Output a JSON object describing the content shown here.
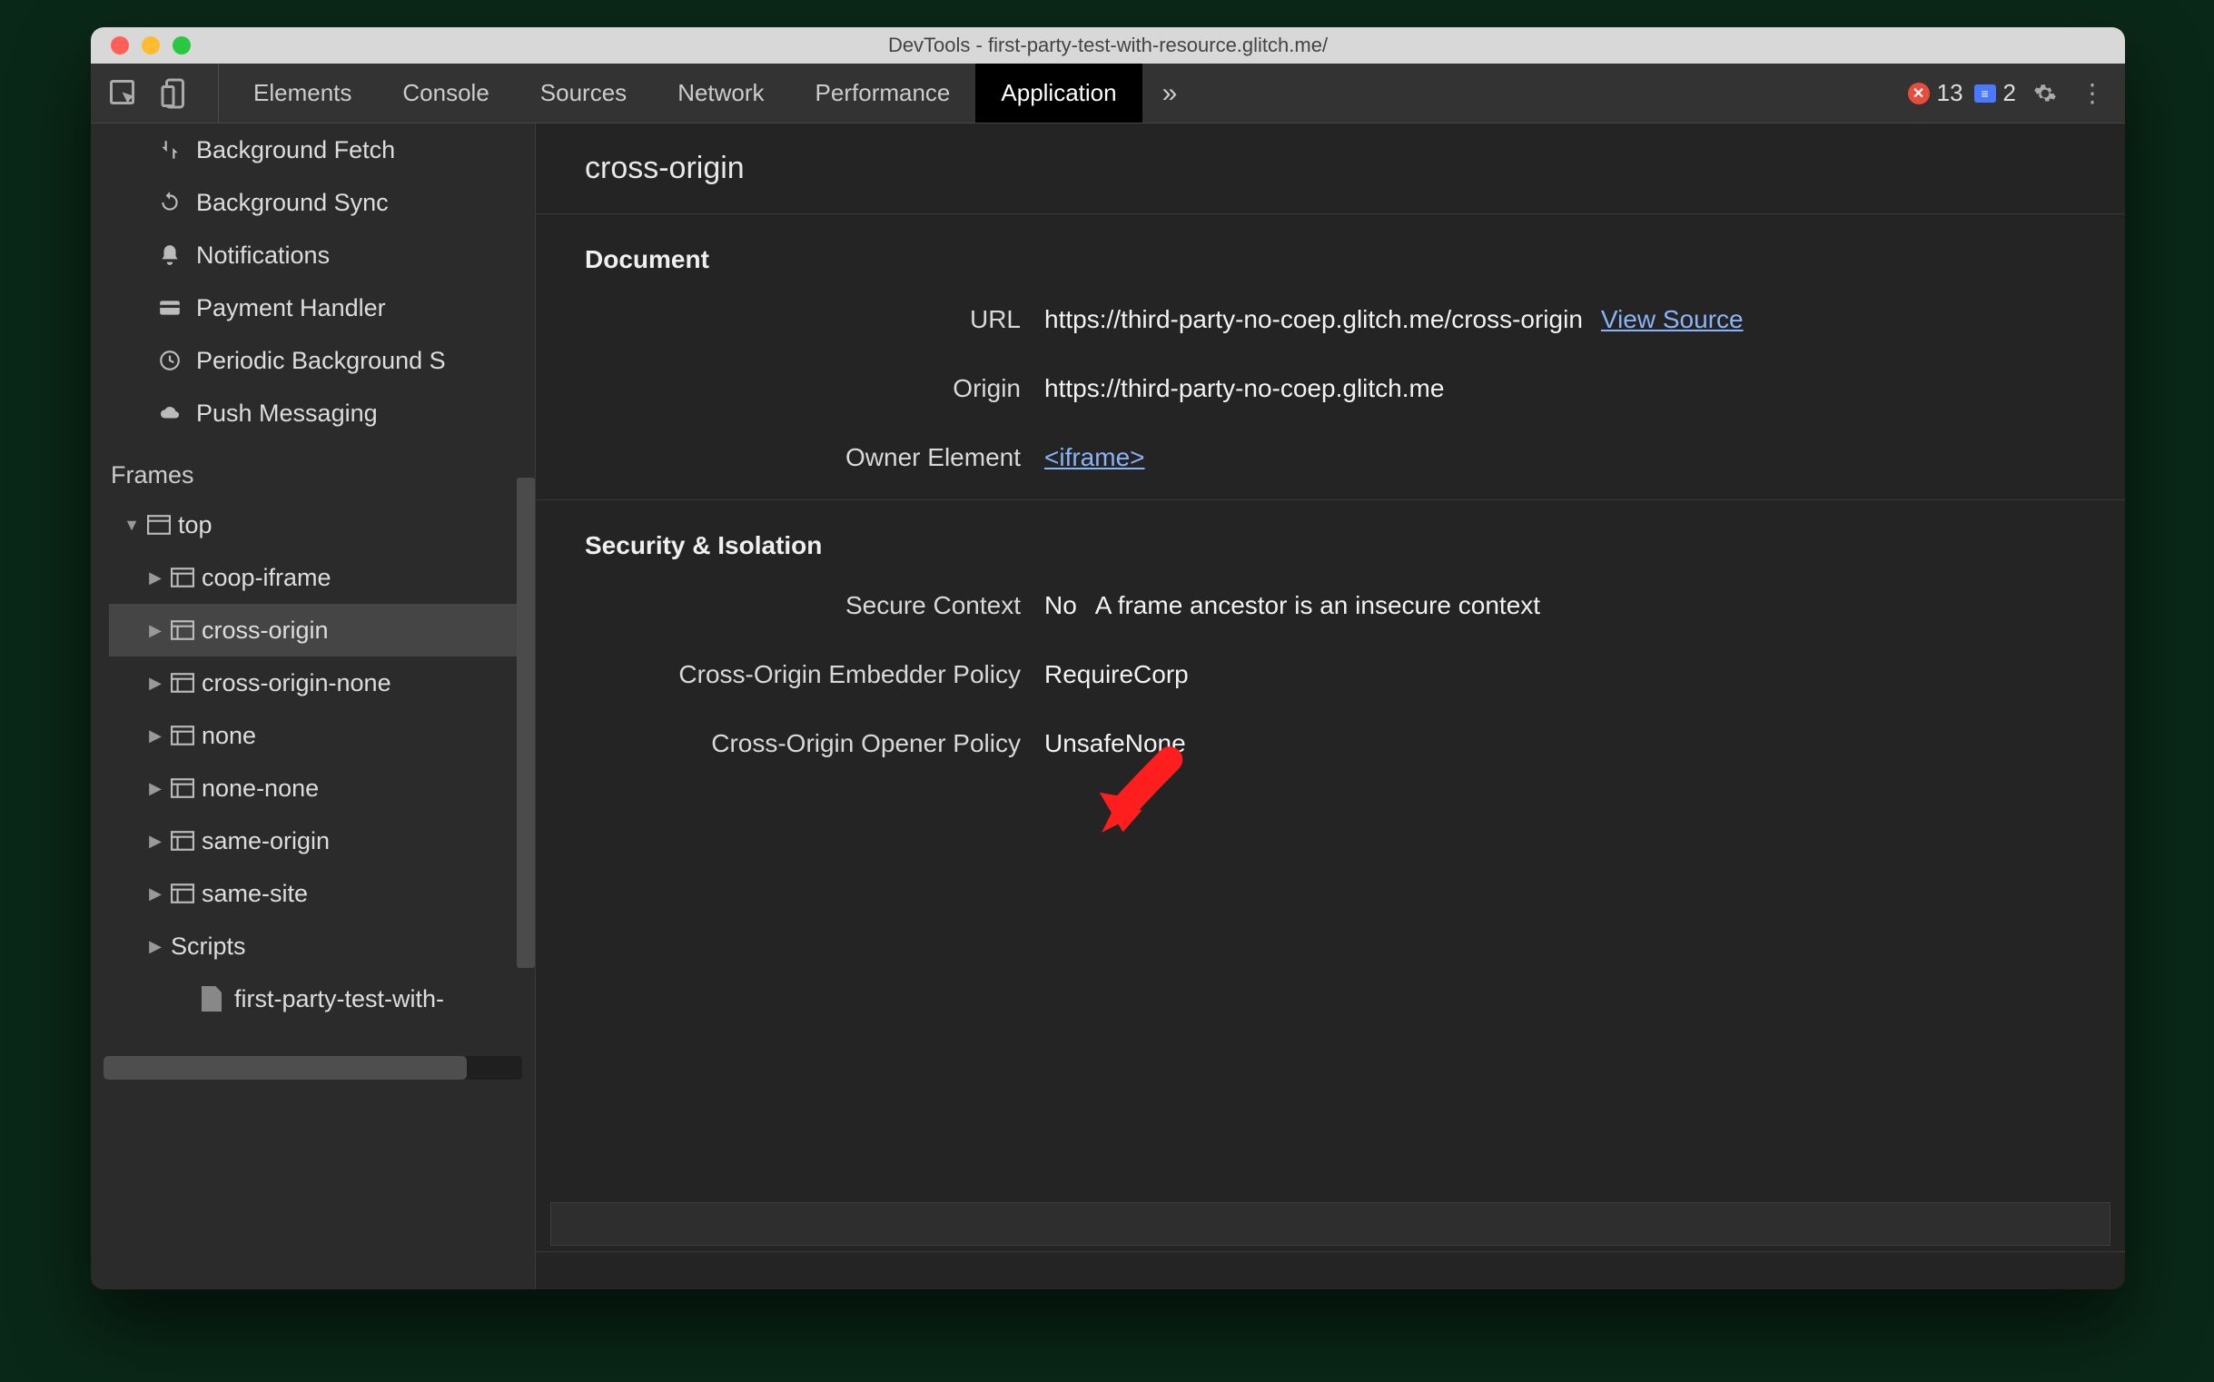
{
  "titlebar": {
    "title": "DevTools - first-party-test-with-resource.glitch.me/"
  },
  "tabs": {
    "items": [
      "Elements",
      "Console",
      "Sources",
      "Network",
      "Performance",
      "Application"
    ],
    "active": "Application",
    "more_glyph": "»"
  },
  "counters": {
    "errors": "13",
    "info": "2"
  },
  "sidebar": {
    "items": [
      {
        "icon": "fetch",
        "label": "Background Fetch"
      },
      {
        "icon": "sync",
        "label": "Background Sync"
      },
      {
        "icon": "bell",
        "label": "Notifications"
      },
      {
        "icon": "card",
        "label": "Payment Handler"
      },
      {
        "icon": "clock",
        "label": "Periodic Background S"
      },
      {
        "icon": "cloud",
        "label": "Push Messaging"
      }
    ],
    "frames_header": "Frames",
    "tree": {
      "top": "top",
      "children": [
        "coop-iframe",
        "cross-origin",
        "cross-origin-none",
        "none",
        "none-none",
        "same-origin",
        "same-site"
      ],
      "selected": "cross-origin",
      "scripts_label": "Scripts",
      "script_item": "first-party-test-with-"
    }
  },
  "main": {
    "title": "cross-origin",
    "document_header": "Document",
    "url_label": "URL",
    "url_value": "https://third-party-no-coep.glitch.me/cross-origin",
    "view_source": "View Source",
    "origin_label": "Origin",
    "origin_value": "https://third-party-no-coep.glitch.me",
    "owner_label": "Owner Element",
    "owner_value": "<iframe>",
    "security_header": "Security & Isolation",
    "secure_ctx_label": "Secure Context",
    "secure_ctx_value": "No",
    "secure_ctx_note": "A frame ancestor is an insecure context",
    "coep_label": "Cross-Origin Embedder Policy",
    "coep_value": "RequireCorp",
    "coop_label": "Cross-Origin Opener Policy",
    "coop_value": "UnsafeNone"
  }
}
